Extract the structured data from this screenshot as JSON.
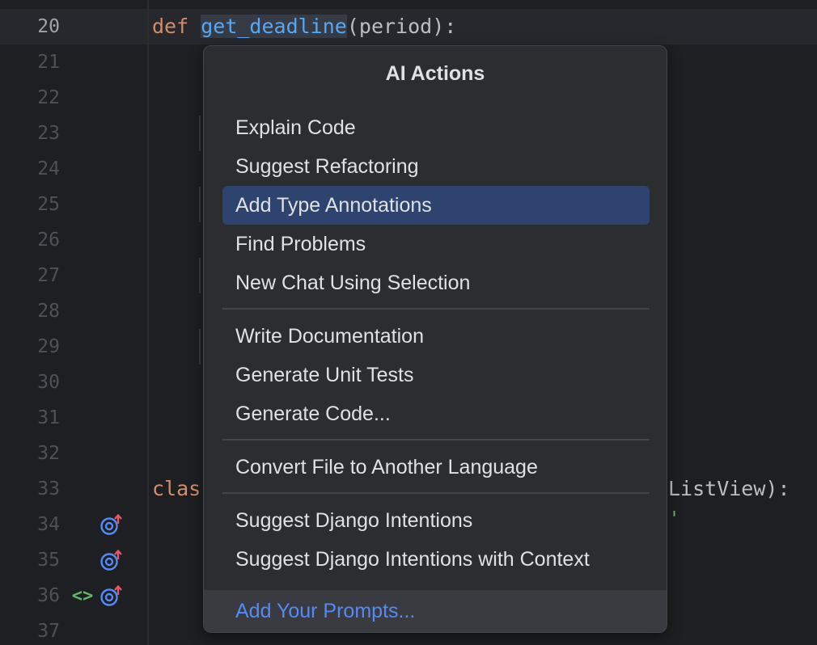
{
  "editor": {
    "line_numbers": [
      "20",
      "21",
      "22",
      "23",
      "24",
      "25",
      "26",
      "27",
      "28",
      "29",
      "30",
      "31",
      "32",
      "33",
      "34",
      "35",
      "36",
      "37"
    ],
    "line20": {
      "kw": "def",
      "fn": "get_deadline",
      "rest": "(period):"
    },
    "line33": {
      "kw": "clas",
      "rest": "ListView):"
    },
    "line34_fragment": "'",
    "gutter_icons": {
      "override": "override-up-icon",
      "code": "code-brackets-icon",
      "code_glyph": "<>"
    },
    "colors": {
      "keyword": "#cf8e6d",
      "function": "#56a8f5",
      "string": "#6aab73"
    }
  },
  "popup": {
    "title": "AI Actions",
    "groups": [
      [
        "Explain Code",
        "Suggest Refactoring",
        "Add Type Annotations",
        "Find Problems",
        "New Chat Using Selection"
      ],
      [
        "Write Documentation",
        "Generate Unit Tests",
        "Generate Code..."
      ],
      [
        "Convert File to Another Language"
      ],
      [
        "Suggest Django Intentions",
        "Suggest Django Intentions with Context"
      ]
    ],
    "selected": "Add Type Annotations",
    "footer_link": "Add Your Prompts...",
    "colors": {
      "selected_bg": "#2e436e",
      "link": "#548af7"
    }
  }
}
